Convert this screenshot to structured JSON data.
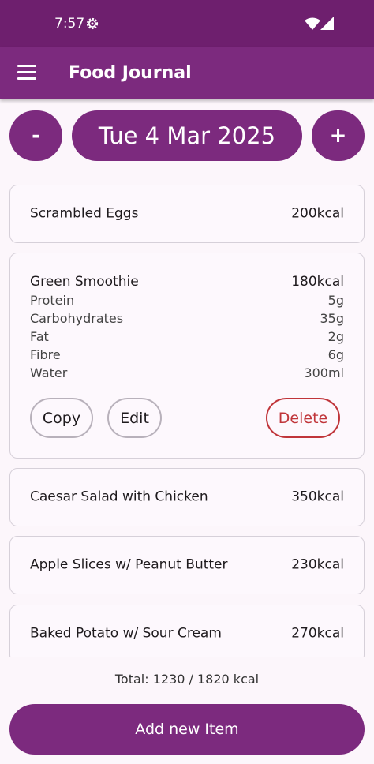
{
  "status": {
    "time": "7:57",
    "icons": [
      "settings-gear-icon",
      "wifi-icon",
      "cell-signal-icon"
    ]
  },
  "app_bar": {
    "title": "Food Journal",
    "menu_icon": "hamburger-menu-icon"
  },
  "date_nav": {
    "prev_label": "-",
    "date_label": "Tue 4 Mar 2025",
    "next_label": "+"
  },
  "entries": [
    {
      "name": "Scrambled Eggs",
      "kcal": "200kcal"
    },
    {
      "name": "Green Smoothie",
      "kcal": "180kcal",
      "nutrients": [
        {
          "label": "Protein",
          "value": "5g"
        },
        {
          "label": "Carbohydrates",
          "value": "35g"
        },
        {
          "label": "Fat",
          "value": "2g"
        },
        {
          "label": "Fibre",
          "value": "6g"
        },
        {
          "label": "Water",
          "value": "300ml"
        }
      ],
      "actions": {
        "copy": "Copy",
        "edit": "Edit",
        "delete": "Delete"
      }
    },
    {
      "name": "Caesar Salad with Chicken",
      "kcal": "350kcal"
    },
    {
      "name": "Apple Slices w/ Peanut Butter",
      "kcal": "230kcal"
    },
    {
      "name": "Baked Potato w/ Sour Cream",
      "kcal": "270kcal"
    }
  ],
  "total_text": "Total: 1230 / 1820 kcal",
  "add_button": "Add new Item",
  "colors": {
    "primary": "#7c2a7e",
    "status_bar": "#6e1f6e",
    "danger": "#c0353a",
    "background": "#fcf6fb"
  }
}
